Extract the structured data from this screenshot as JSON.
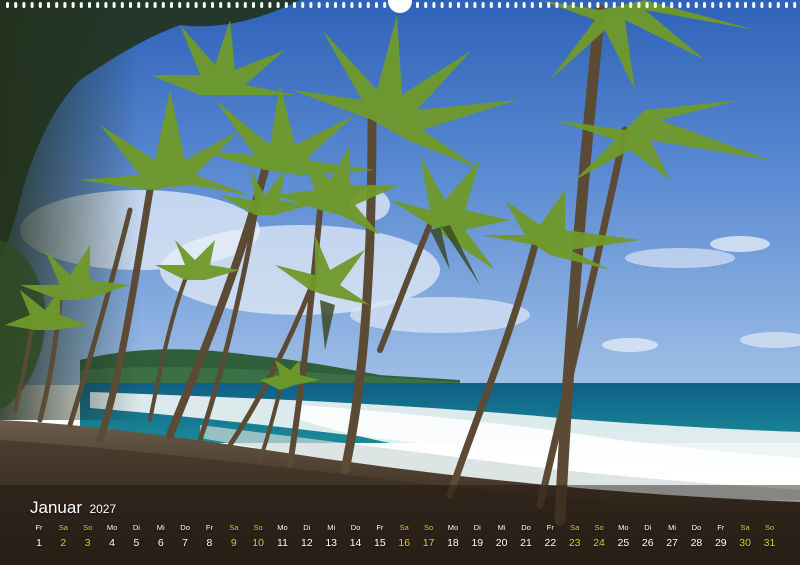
{
  "calendar": {
    "month": "Januar",
    "year": "2027",
    "weekend_color": "#d4cc3a",
    "days": [
      {
        "wd": "Fr",
        "n": "1",
        "weekend": false
      },
      {
        "wd": "Sa",
        "n": "2",
        "weekend": true
      },
      {
        "wd": "So",
        "n": "3",
        "weekend": true
      },
      {
        "wd": "Mo",
        "n": "4",
        "weekend": false
      },
      {
        "wd": "Di",
        "n": "5",
        "weekend": false
      },
      {
        "wd": "Mi",
        "n": "6",
        "weekend": false
      },
      {
        "wd": "Do",
        "n": "7",
        "weekend": false
      },
      {
        "wd": "Fr",
        "n": "8",
        "weekend": false
      },
      {
        "wd": "Sa",
        "n": "9",
        "weekend": true
      },
      {
        "wd": "So",
        "n": "10",
        "weekend": true
      },
      {
        "wd": "Mo",
        "n": "11",
        "weekend": false
      },
      {
        "wd": "Di",
        "n": "12",
        "weekend": false
      },
      {
        "wd": "Mi",
        "n": "13",
        "weekend": false
      },
      {
        "wd": "Do",
        "n": "14",
        "weekend": false
      },
      {
        "wd": "Fr",
        "n": "15",
        "weekend": false
      },
      {
        "wd": "Sa",
        "n": "16",
        "weekend": true
      },
      {
        "wd": "So",
        "n": "17",
        "weekend": true
      },
      {
        "wd": "Mo",
        "n": "18",
        "weekend": false
      },
      {
        "wd": "Di",
        "n": "19",
        "weekend": false
      },
      {
        "wd": "Mi",
        "n": "20",
        "weekend": false
      },
      {
        "wd": "Do",
        "n": "21",
        "weekend": false
      },
      {
        "wd": "Fr",
        "n": "22",
        "weekend": false
      },
      {
        "wd": "Sa",
        "n": "23",
        "weekend": true
      },
      {
        "wd": "So",
        "n": "24",
        "weekend": true
      },
      {
        "wd": "Mo",
        "n": "25",
        "weekend": false
      },
      {
        "wd": "Di",
        "n": "26",
        "weekend": false
      },
      {
        "wd": "Mi",
        "n": "27",
        "weekend": false
      },
      {
        "wd": "Do",
        "n": "28",
        "weekend": false
      },
      {
        "wd": "Fr",
        "n": "29",
        "weekend": false
      },
      {
        "wd": "Sa",
        "n": "30",
        "weekend": true
      },
      {
        "wd": "So",
        "n": "31",
        "weekend": true
      }
    ]
  }
}
